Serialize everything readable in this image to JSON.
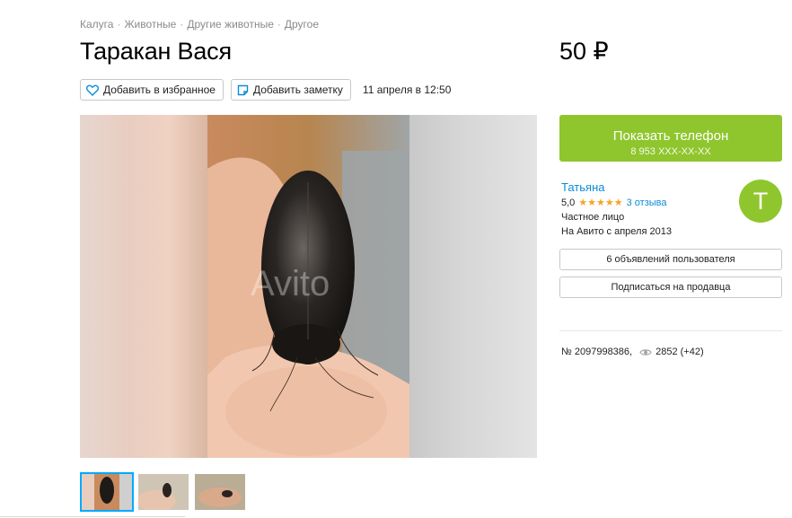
{
  "breadcrumbs": [
    "Калуга",
    "Животные",
    "Другие животные",
    "Другое"
  ],
  "title": "Таракан Вася",
  "price": "50 ₽",
  "actions": {
    "favorite_label": "Добавить в избранное",
    "note_label": "Добавить заметку",
    "date": "11 апреля в 12:50"
  },
  "gallery": {
    "watermark": "Avito",
    "thumbnail_count": 3
  },
  "phone": {
    "label": "Показать телефон",
    "masked_number": "8 953 XXX-XX-XX"
  },
  "seller": {
    "name": "Татьяна",
    "rating": "5,0",
    "stars": "★★★★★",
    "reviews": "3 отзыва",
    "type": "Частное лицо",
    "since": "На Авито с апреля 2013",
    "avatar_letter": "Т"
  },
  "seller_buttons": {
    "listings": "6 объявлений пользователя",
    "subscribe": "Подписаться на продавца"
  },
  "stats": {
    "ad_number": "№ 2097998386,",
    "views": "2852 (+42)"
  },
  "colors": {
    "accent_green": "#8fc62d",
    "link_blue": "#0a8cd8",
    "star_orange": "#f5a623",
    "active_thumb_border": "#00aaff"
  },
  "icons": {
    "favorite": "heart-icon",
    "note": "note-icon",
    "views": "eye-icon"
  }
}
